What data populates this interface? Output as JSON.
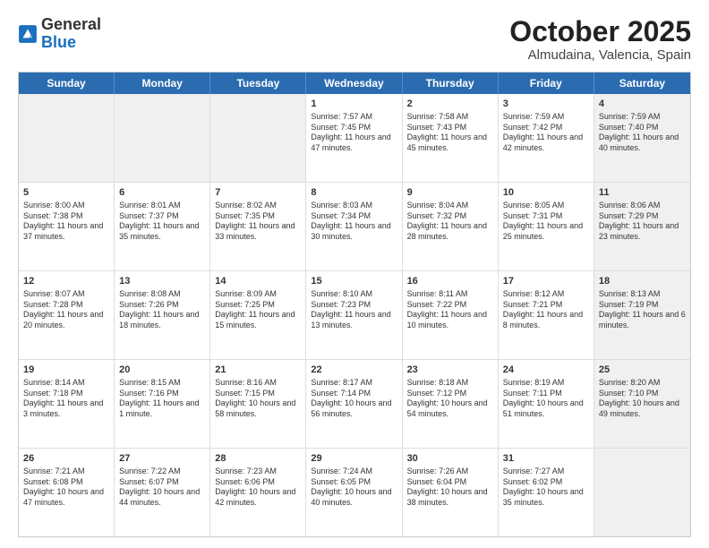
{
  "header": {
    "logo_general": "General",
    "logo_blue": "Blue",
    "month_title": "October 2025",
    "location": "Almudaina, Valencia, Spain"
  },
  "days_of_week": [
    "Sunday",
    "Monday",
    "Tuesday",
    "Wednesday",
    "Thursday",
    "Friday",
    "Saturday"
  ],
  "weeks": [
    [
      {
        "day": "",
        "info": "",
        "shaded": true
      },
      {
        "day": "",
        "info": "",
        "shaded": true
      },
      {
        "day": "",
        "info": "",
        "shaded": true
      },
      {
        "day": "1",
        "info": "Sunrise: 7:57 AM\nSunset: 7:45 PM\nDaylight: 11 hours and 47 minutes."
      },
      {
        "day": "2",
        "info": "Sunrise: 7:58 AM\nSunset: 7:43 PM\nDaylight: 11 hours and 45 minutes."
      },
      {
        "day": "3",
        "info": "Sunrise: 7:59 AM\nSunset: 7:42 PM\nDaylight: 11 hours and 42 minutes."
      },
      {
        "day": "4",
        "info": "Sunrise: 7:59 AM\nSunset: 7:40 PM\nDaylight: 11 hours and 40 minutes.",
        "shaded": true
      }
    ],
    [
      {
        "day": "5",
        "info": "Sunrise: 8:00 AM\nSunset: 7:38 PM\nDaylight: 11 hours and 37 minutes."
      },
      {
        "day": "6",
        "info": "Sunrise: 8:01 AM\nSunset: 7:37 PM\nDaylight: 11 hours and 35 minutes."
      },
      {
        "day": "7",
        "info": "Sunrise: 8:02 AM\nSunset: 7:35 PM\nDaylight: 11 hours and 33 minutes."
      },
      {
        "day": "8",
        "info": "Sunrise: 8:03 AM\nSunset: 7:34 PM\nDaylight: 11 hours and 30 minutes."
      },
      {
        "day": "9",
        "info": "Sunrise: 8:04 AM\nSunset: 7:32 PM\nDaylight: 11 hours and 28 minutes."
      },
      {
        "day": "10",
        "info": "Sunrise: 8:05 AM\nSunset: 7:31 PM\nDaylight: 11 hours and 25 minutes."
      },
      {
        "day": "11",
        "info": "Sunrise: 8:06 AM\nSunset: 7:29 PM\nDaylight: 11 hours and 23 minutes.",
        "shaded": true
      }
    ],
    [
      {
        "day": "12",
        "info": "Sunrise: 8:07 AM\nSunset: 7:28 PM\nDaylight: 11 hours and 20 minutes."
      },
      {
        "day": "13",
        "info": "Sunrise: 8:08 AM\nSunset: 7:26 PM\nDaylight: 11 hours and 18 minutes."
      },
      {
        "day": "14",
        "info": "Sunrise: 8:09 AM\nSunset: 7:25 PM\nDaylight: 11 hours and 15 minutes."
      },
      {
        "day": "15",
        "info": "Sunrise: 8:10 AM\nSunset: 7:23 PM\nDaylight: 11 hours and 13 minutes."
      },
      {
        "day": "16",
        "info": "Sunrise: 8:11 AM\nSunset: 7:22 PM\nDaylight: 11 hours and 10 minutes."
      },
      {
        "day": "17",
        "info": "Sunrise: 8:12 AM\nSunset: 7:21 PM\nDaylight: 11 hours and 8 minutes."
      },
      {
        "day": "18",
        "info": "Sunrise: 8:13 AM\nSunset: 7:19 PM\nDaylight: 11 hours and 6 minutes.",
        "shaded": true
      }
    ],
    [
      {
        "day": "19",
        "info": "Sunrise: 8:14 AM\nSunset: 7:18 PM\nDaylight: 11 hours and 3 minutes."
      },
      {
        "day": "20",
        "info": "Sunrise: 8:15 AM\nSunset: 7:16 PM\nDaylight: 11 hours and 1 minute."
      },
      {
        "day": "21",
        "info": "Sunrise: 8:16 AM\nSunset: 7:15 PM\nDaylight: 10 hours and 58 minutes."
      },
      {
        "day": "22",
        "info": "Sunrise: 8:17 AM\nSunset: 7:14 PM\nDaylight: 10 hours and 56 minutes."
      },
      {
        "day": "23",
        "info": "Sunrise: 8:18 AM\nSunset: 7:12 PM\nDaylight: 10 hours and 54 minutes."
      },
      {
        "day": "24",
        "info": "Sunrise: 8:19 AM\nSunset: 7:11 PM\nDaylight: 10 hours and 51 minutes."
      },
      {
        "day": "25",
        "info": "Sunrise: 8:20 AM\nSunset: 7:10 PM\nDaylight: 10 hours and 49 minutes.",
        "shaded": true
      }
    ],
    [
      {
        "day": "26",
        "info": "Sunrise: 7:21 AM\nSunset: 6:08 PM\nDaylight: 10 hours and 47 minutes."
      },
      {
        "day": "27",
        "info": "Sunrise: 7:22 AM\nSunset: 6:07 PM\nDaylight: 10 hours and 44 minutes."
      },
      {
        "day": "28",
        "info": "Sunrise: 7:23 AM\nSunset: 6:06 PM\nDaylight: 10 hours and 42 minutes."
      },
      {
        "day": "29",
        "info": "Sunrise: 7:24 AM\nSunset: 6:05 PM\nDaylight: 10 hours and 40 minutes."
      },
      {
        "day": "30",
        "info": "Sunrise: 7:26 AM\nSunset: 6:04 PM\nDaylight: 10 hours and 38 minutes."
      },
      {
        "day": "31",
        "info": "Sunrise: 7:27 AM\nSunset: 6:02 PM\nDaylight: 10 hours and 35 minutes."
      },
      {
        "day": "",
        "info": "",
        "shaded": true
      }
    ]
  ]
}
